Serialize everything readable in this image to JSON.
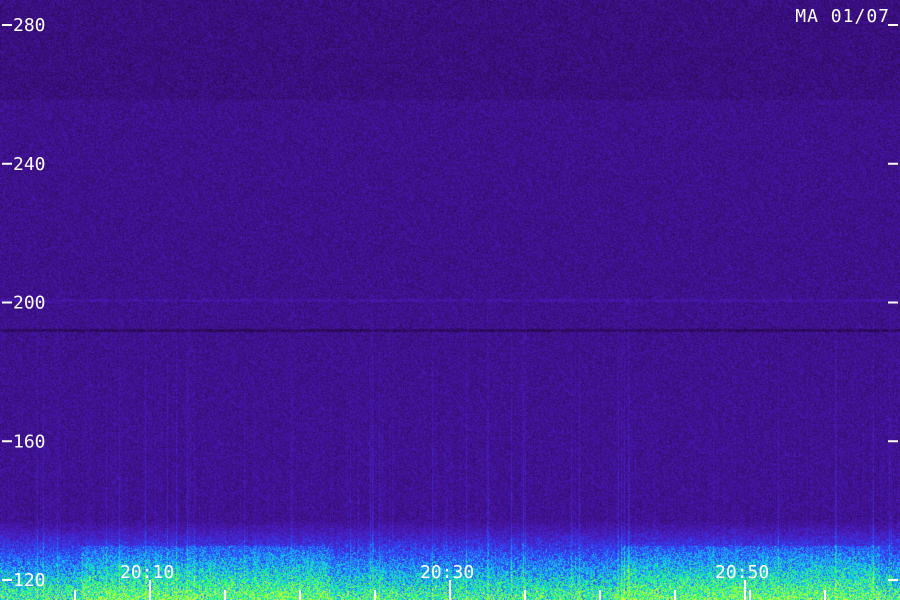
{
  "station_label": "MA 01/07",
  "chart_data": {
    "type": "heatmap",
    "title": "",
    "xlabel": "",
    "ylabel": "",
    "y_ticks": [
      {
        "value": 280,
        "label": "280"
      },
      {
        "value": 240,
        "label": "240"
      },
      {
        "value": 200,
        "label": "200"
      },
      {
        "value": 160,
        "label": "160"
      },
      {
        "value": 120,
        "label": "120"
      }
    ],
    "ylim": [
      120,
      285
    ],
    "x_ticks": [
      {
        "value": "20:10",
        "label": "20:10"
      },
      {
        "value": "20:30",
        "label": "20:30"
      },
      {
        "value": "20:50",
        "label": "20:50"
      }
    ],
    "colormap": [
      "#1a0630",
      "#3a0d7a",
      "#4b1cc0",
      "#2a4bff",
      "#16c8ff",
      "#22ff66",
      "#c8ff40"
    ],
    "background_color": "#1a0630",
    "label_color": "#ffffff"
  }
}
